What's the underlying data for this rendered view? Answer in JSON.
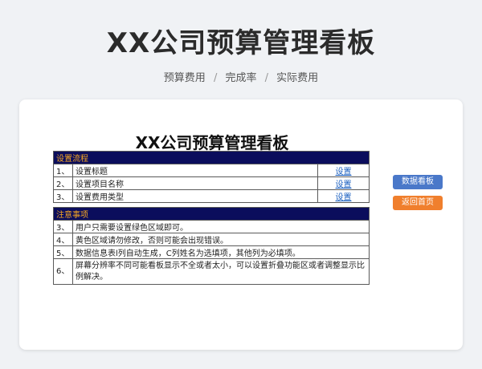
{
  "header": {
    "title": "XX公司预算管理看板",
    "tags": [
      "预算费用",
      "完成率",
      "实际费用"
    ],
    "separator": "/"
  },
  "sheet": {
    "title": "XX公司预算管理看板",
    "setup_header": "设置流程",
    "setup_rows": [
      {
        "num": "1、",
        "label": "设置标题",
        "action": "设置"
      },
      {
        "num": "2、",
        "label": "设置项目名称",
        "action": "设置"
      },
      {
        "num": "3、",
        "label": "设置费用类型",
        "action": "设置"
      }
    ],
    "notes_header": "注意事项",
    "notes_rows": [
      {
        "num": "3、",
        "text": "用户只需要设置绿色区域即可。"
      },
      {
        "num": "4、",
        "text": "黄色区域请勿修改，否则可能会出现错误。"
      },
      {
        "num": "5、",
        "text": "数据信息表l列自动生成，C列姓名为选填项，其他列为必填项。"
      },
      {
        "num": "6、",
        "text": "屏幕分辨率不同可能看板显示不全或者太小，可以设置折叠功能区或者调整显示比例解决。"
      }
    ]
  },
  "buttons": {
    "dashboard": "数据看板",
    "home": "返回首页"
  },
  "colors": {
    "header_bg": "#0b0d5c",
    "header_text": "#f5a623",
    "dashboard_btn": "#4a78c9",
    "home_btn": "#f07f2d",
    "link": "#1a5fc0"
  }
}
